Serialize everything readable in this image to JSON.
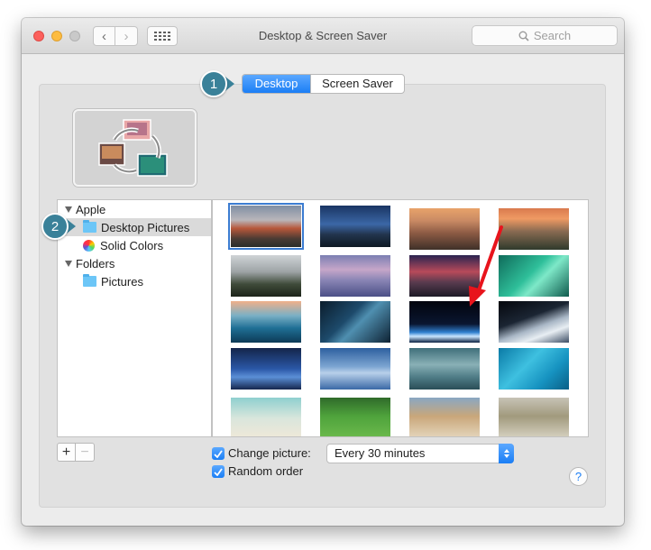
{
  "window": {
    "title": "Desktop & Screen Saver"
  },
  "search": {
    "label": "Search"
  },
  "tabs": [
    {
      "label": "Desktop"
    },
    {
      "label": "Screen Saver"
    }
  ],
  "callouts": [
    {
      "label": "1"
    },
    {
      "label": "2"
    }
  ],
  "sidebar": {
    "items": [
      {
        "label": "Apple"
      },
      {
        "label": "Desktop Pictures"
      },
      {
        "label": "Solid Colors"
      },
      {
        "label": "Folders"
      },
      {
        "label": "Pictures"
      }
    ]
  },
  "options": {
    "change_picture_label": "Change picture:",
    "change_picture_checked": true,
    "interval_value": "Every 30 minutes",
    "random_order_label": "Random order",
    "random_order_checked": true
  },
  "buttons": {
    "add": "+",
    "remove": "−",
    "help": "?"
  },
  "colors": {
    "accent": "#1b7ef5",
    "callout": "#3a8199",
    "arrow": "#e8141c"
  }
}
